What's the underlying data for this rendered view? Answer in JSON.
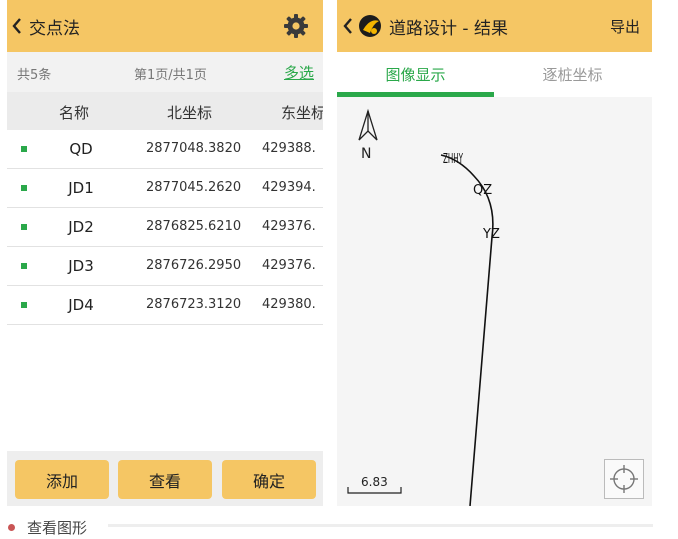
{
  "left_screen": {
    "title": "交点法",
    "pager": {
      "count": "共5条",
      "page": "第1页/共1页",
      "multi_select": "多选"
    },
    "columns": [
      "名称",
      "北坐标",
      "东坐标"
    ],
    "rows": [
      {
        "name": "QD",
        "north": "2877048.3820",
        "east": "429388."
      },
      {
        "name": "JD1",
        "north": "2877045.2620",
        "east": "429394."
      },
      {
        "name": "JD2",
        "north": "2876825.6210",
        "east": "429376."
      },
      {
        "name": "JD3",
        "north": "2876726.2950",
        "east": "429376."
      },
      {
        "name": "JD4",
        "north": "2876723.3120",
        "east": "429380."
      }
    ],
    "buttons": {
      "add": "添加",
      "view": "查看",
      "ok": "确定"
    }
  },
  "right_screen": {
    "title": "道路设计 - 结果",
    "export": "导出",
    "tabs": {
      "graphic": "图像显示",
      "stake": "逐桩坐标"
    },
    "map": {
      "north_label": "N",
      "points": {
        "zh_hy": "ZHHY",
        "qz": "QZ",
        "yz": "YZ"
      },
      "scale_value": "6.83"
    }
  },
  "caption": "查看图形",
  "colors": {
    "header": "#f5c664",
    "accent": "#2aa84a",
    "bullet": "#c95555"
  }
}
